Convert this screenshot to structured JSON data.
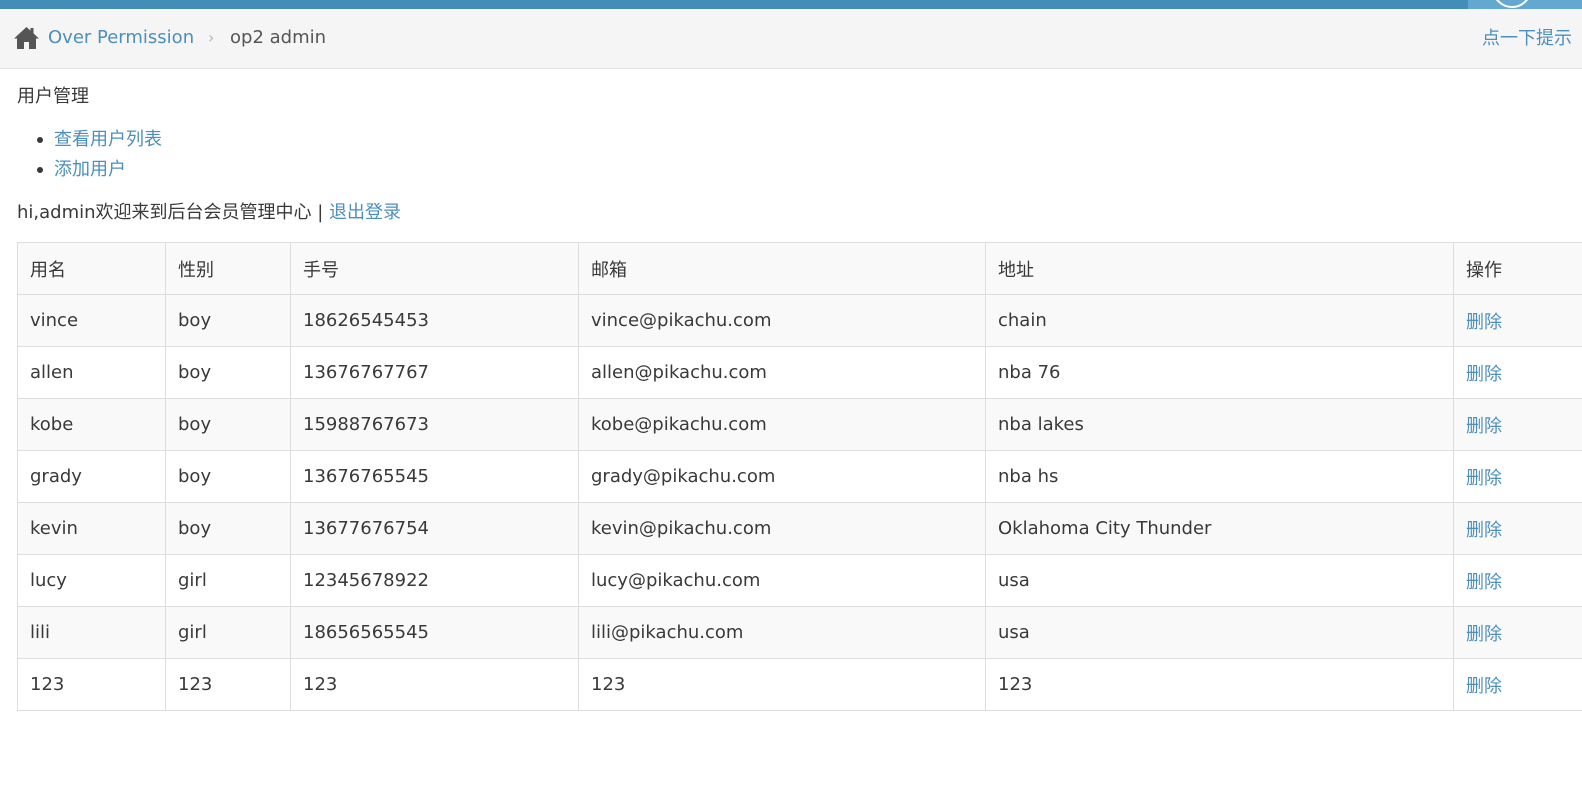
{
  "breadcrumb": {
    "parent_label": "Over Permission",
    "separator": "›",
    "current_label": "op2 admin"
  },
  "tip_link": "点一下提示",
  "section_title": "用户管理",
  "menu": {
    "items": [
      {
        "label": "查看用户列表"
      },
      {
        "label": "添加用户"
      }
    ]
  },
  "welcome": {
    "text": "hi,admin欢迎来到后台会员管理中心 | ",
    "logout_label": "退出登录"
  },
  "table": {
    "headers": [
      "用名",
      "性别",
      "手号",
      "邮箱",
      "地址",
      "操作"
    ],
    "rows": [
      [
        "vince",
        "boy",
        "18626545453",
        "vince@pikachu.com",
        "chain",
        "删除"
      ],
      [
        "allen",
        "boy",
        "13676767767",
        "allen@pikachu.com",
        "nba 76",
        "删除"
      ],
      [
        "kobe",
        "boy",
        "15988767673",
        "kobe@pikachu.com",
        "nba lakes",
        "删除"
      ],
      [
        "grady",
        "boy",
        "13676765545",
        "grady@pikachu.com",
        "nba hs",
        "删除"
      ],
      [
        "kevin",
        "boy",
        "13677676754",
        "kevin@pikachu.com",
        "Oklahoma City Thunder",
        "删除"
      ],
      [
        "lucy",
        "girl",
        "12345678922",
        "lucy@pikachu.com",
        "usa",
        "删除"
      ],
      [
        "lili",
        "girl",
        "18656565545",
        "lili@pikachu.com",
        "usa",
        "删除"
      ],
      [
        "123",
        "123",
        "123",
        "123",
        "123",
        "删除"
      ]
    ]
  },
  "icons": {
    "home": "home-icon",
    "separator": "chevron-right-icon"
  },
  "colors": {
    "topbar": "#438eb9",
    "link": "#4c8fbd",
    "breadcrumb_bg": "#f5f5f5",
    "text": "#393939",
    "table_border": "#dddddd",
    "stripe": "#f9f9f9"
  }
}
